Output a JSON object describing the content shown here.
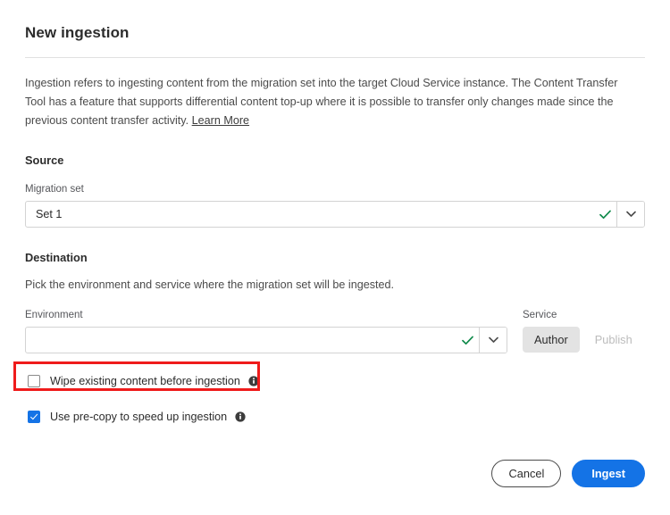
{
  "dialog": {
    "title": "New ingestion",
    "description_part1": "Ingestion refers to ingesting content from the migration set into the target Cloud Service instance. The Content Transfer Tool has a feature that supports differential content top-up where it is possible to transfer only changes made since the previous content transfer activity. ",
    "learn_more_label": "Learn More"
  },
  "source": {
    "heading": "Source",
    "migration_set": {
      "label": "Migration set",
      "value": "Set 1",
      "valid_icon": "check-icon",
      "arrow_icon": "chevron-down-icon"
    }
  },
  "destination": {
    "heading": "Destination",
    "note": "Pick the environment and service where the migration set will be ingested.",
    "environment": {
      "label": "Environment",
      "value": "",
      "placeholder": "",
      "valid_icon": "check-icon",
      "arrow_icon": "chevron-down-icon"
    },
    "service": {
      "label": "Service",
      "options": [
        {
          "label": "Author",
          "state": "selected"
        },
        {
          "label": "Publish",
          "state": "disabled"
        }
      ]
    }
  },
  "options": {
    "wipe": {
      "label": "Wipe existing content before ingestion",
      "checked": false,
      "info_icon": "info-icon"
    },
    "precopy": {
      "label": "Use pre-copy to speed up ingestion",
      "checked": true,
      "info_icon": "info-icon"
    }
  },
  "footer": {
    "cancel_label": "Cancel",
    "ingest_label": "Ingest"
  },
  "colors": {
    "accent_blue": "#1473e6",
    "valid_green": "#0f8a4a",
    "highlight_red": "#ef1b1b",
    "selected_gray": "#e3e3e3",
    "disabled_gray": "#bcbcbc"
  }
}
